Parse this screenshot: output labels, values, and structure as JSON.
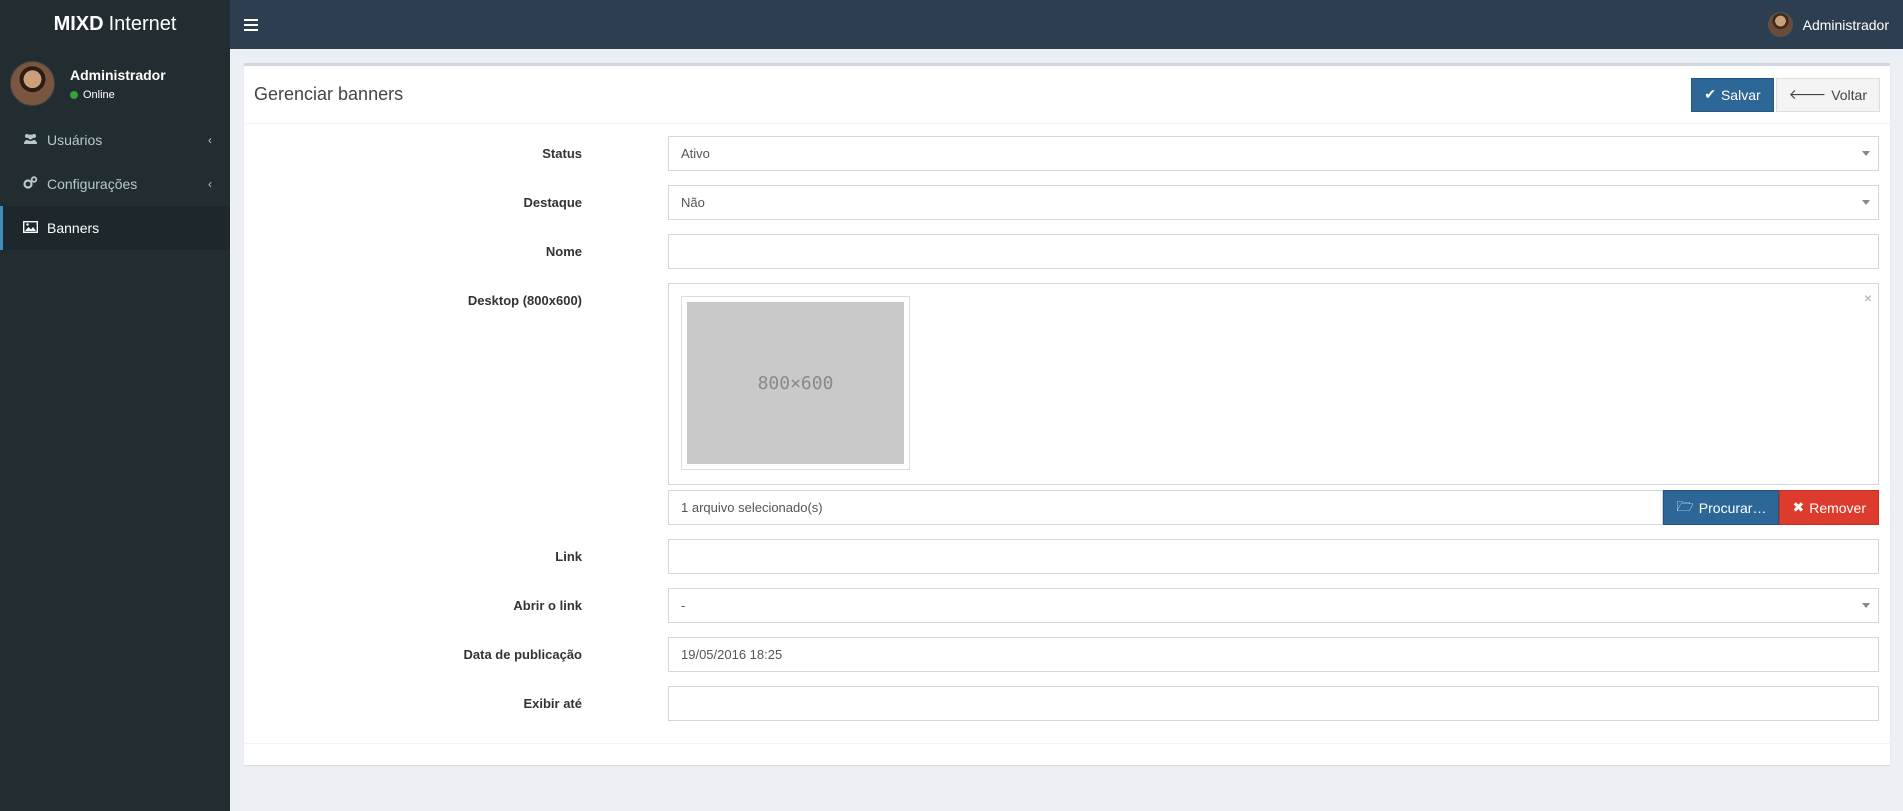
{
  "app": {
    "logo_bold": "MIXD",
    "logo_light": "Internet"
  },
  "header": {
    "user_name": "Administrador"
  },
  "sidebar": {
    "user": {
      "name": "Administrador",
      "status": "Online"
    },
    "items": [
      {
        "label": "Usuários",
        "icon": "users-icon"
      },
      {
        "label": "Configurações",
        "icon": "cogs-icon"
      },
      {
        "label": "Banners",
        "icon": "image-icon"
      }
    ]
  },
  "page": {
    "title": "Gerenciar banners",
    "save_label": "Salvar",
    "back_label": "Voltar"
  },
  "form": {
    "status": {
      "label": "Status",
      "value": "Ativo"
    },
    "destaque": {
      "label": "Destaque",
      "value": "Não"
    },
    "nome": {
      "label": "Nome",
      "value": ""
    },
    "desktop": {
      "label": "Desktop (800x600)",
      "preview_text": "800×600",
      "caption": "1 arquivo selecionado(s)",
      "browse_label": "Procurar…",
      "remove_label": "Remover"
    },
    "link": {
      "label": "Link",
      "value": ""
    },
    "abrir_link": {
      "label": "Abrir o link",
      "value": "-"
    },
    "data_publicacao": {
      "label": "Data de publicação",
      "value": "19/05/2016 18:25"
    },
    "exibir_ate": {
      "label": "Exibir até",
      "value": ""
    }
  },
  "colors": {
    "primary": "#2c6797",
    "danger": "#dd3b2e",
    "sidebar": "#222d32",
    "navbar": "#2c3e50"
  }
}
